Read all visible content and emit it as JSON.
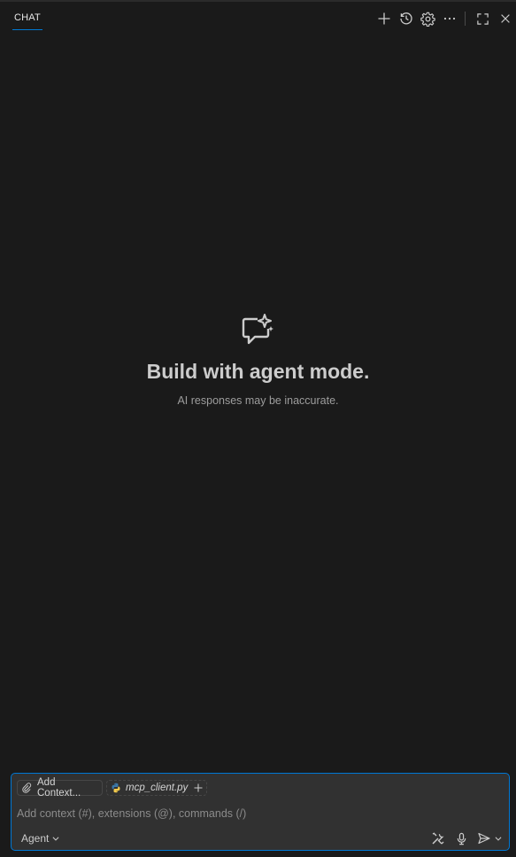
{
  "header": {
    "tab_label": "CHAT",
    "actions": [
      {
        "name": "new-chat",
        "icon": "plus-icon"
      },
      {
        "name": "history",
        "icon": "history-icon"
      },
      {
        "name": "settings",
        "icon": "gear-icon"
      },
      {
        "name": "more",
        "icon": "ellipsis-icon"
      },
      {
        "name": "maximize",
        "icon": "maximize-icon"
      },
      {
        "name": "close",
        "icon": "close-icon"
      }
    ]
  },
  "empty_state": {
    "icon": "chat-sparkle-icon",
    "title": "Build with agent mode.",
    "subtitle": "AI responses may be inaccurate."
  },
  "input": {
    "add_context_label": "Add Context...",
    "attached_file": "mcp_client.py",
    "placeholder": "Add context (#), extensions (@), commands (/)",
    "value": "",
    "mode_label": "Agent",
    "toolbar_icons": [
      "tools-icon",
      "microphone-icon",
      "send-icon",
      "chevron-down-icon"
    ]
  },
  "colors": {
    "background": "#1a1a1a",
    "input_background": "#313131",
    "accent": "#0078d4",
    "text": "#cccccc",
    "muted_text": "#9d9d9d"
  }
}
